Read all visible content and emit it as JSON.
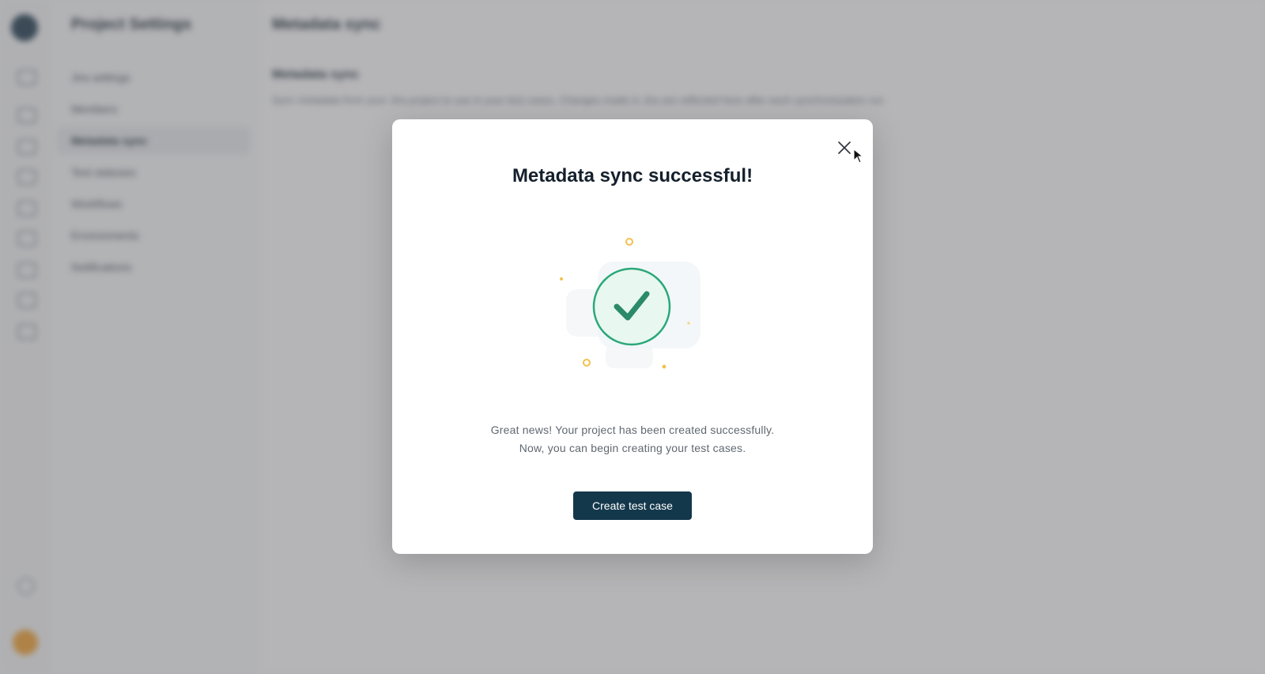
{
  "background": {
    "sidebar_title": "Project Settings",
    "sidebar_items": [
      "Jira settings",
      "Members",
      "Metadata sync",
      "Test statuses",
      "Workflows",
      "Environments",
      "Notifications"
    ],
    "active_item_index": 2,
    "page_title": "Metadata sync",
    "section_title": "Metadata sync",
    "section_description": "Sync metadata from your Jira project to use in your test cases. Changes made in Jira are reflected here after each synchronization run."
  },
  "modal": {
    "title": "Metadata sync successful!",
    "message_line1": "Great news! Your project has been created successfully.",
    "message_line2": "Now, you can begin creating your test cases.",
    "primary_button": "Create test case",
    "close_icon": "close-icon",
    "illustration_icon": "check-circle-icon"
  },
  "colors": {
    "primary_button": "#14384b",
    "success_green": "#2aa87a",
    "confetti": "#f2c14e",
    "overlay": "rgba(95,95,100,0.45)"
  }
}
